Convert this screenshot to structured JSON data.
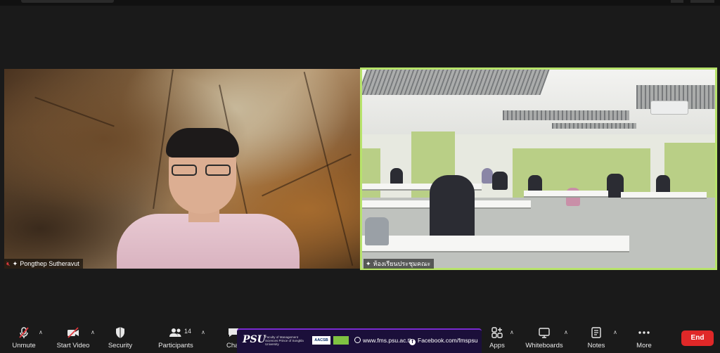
{
  "participants": {
    "left": {
      "name": "Pongthep Sutheravut"
    },
    "right": {
      "name": "ห้องเรียนประชุมคณะ"
    }
  },
  "toolbar": {
    "unmute": "Unmute",
    "start_video": "Start Video",
    "security": "Security",
    "participants": "Participants",
    "participants_count": "14",
    "chat": "Chat",
    "apps": "Apps",
    "whiteboards": "Whiteboards",
    "notes": "Notes",
    "more": "More",
    "end": "End"
  },
  "banner": {
    "logo": "PSU",
    "faculty": "Faculty of Management Sciences Prince of Songkla University",
    "accreditation": "AACSB",
    "website": "www.fms.psu.ac.th",
    "facebook": "Facebook.com/fmspsu"
  },
  "icons": {
    "unmute": "mic-off-icon",
    "start_video": "video-off-icon",
    "security": "shield-icon",
    "participants": "people-icon",
    "chat": "chat-icon",
    "apps": "apps-icon",
    "whiteboards": "whiteboard-icon",
    "notes": "notes-icon",
    "more": "more-icon"
  },
  "colors": {
    "active_speaker_border": "#b7e36b",
    "end_button": "#e02828",
    "muted_icon": "#e0393e"
  }
}
